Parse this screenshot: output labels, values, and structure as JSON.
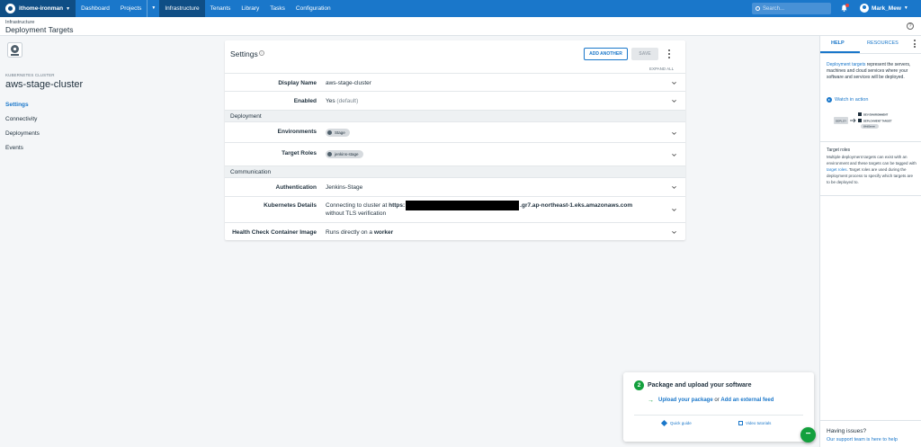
{
  "topbar": {
    "space_name": "ithome-ironman",
    "nav": [
      "Dashboard",
      "Projects",
      "Infrastructure",
      "Tenants",
      "Library",
      "Tasks",
      "Configuration"
    ],
    "active_nav": "Infrastructure",
    "search_placeholder": "Search...",
    "user_name": "Mark_Mew",
    "brand_color": "#1a77ca"
  },
  "subheader": {
    "breadcrumb": "Infrastructure",
    "title": "Deployment Targets"
  },
  "target": {
    "kind": "KUBERNETES CLUSTER",
    "name": "aws-stage-cluster",
    "nav": [
      "Settings",
      "Connectivity",
      "Deployments",
      "Events"
    ],
    "active_nav": "Settings"
  },
  "settings": {
    "title": "Settings",
    "add_another": "ADD ANOTHER",
    "save": "SAVE",
    "expand_all": "EXPAND ALL",
    "rows": {
      "display_name": {
        "label": "Display Name",
        "value": "aws-stage-cluster"
      },
      "enabled": {
        "label": "Enabled",
        "value": "Yes",
        "note": "(default)"
      },
      "environments": {
        "label": "Environments",
        "chip": "Stage"
      },
      "target_roles": {
        "label": "Target Roles",
        "chip": "jenkins-stage"
      },
      "authentication": {
        "label": "Authentication",
        "value": "Jenkins-Stage"
      },
      "kubernetes_details": {
        "label": "Kubernetes Details",
        "prefix": "Connecting to cluster at ",
        "url_start": "https:",
        "url_end": ".gr7.ap-northeast-1.eks.amazonaws.com",
        "line2": "without TLS verification"
      },
      "health_check": {
        "label": "Health Check Container Image",
        "prefix": "Runs directly on a ",
        "bold": "worker"
      }
    },
    "sections": {
      "deployment": "Deployment",
      "communication": "Communication"
    }
  },
  "help": {
    "tab_help": "HELP",
    "tab_resources": "RESOURCES",
    "intro_link": "Deployment targets",
    "intro_text": " represent the servers, machines and cloud services where your software and services will be deployed.",
    "watch": "Watch in action",
    "diagram": {
      "deploy": "DEPLOY",
      "dev_env": "DEV ENVIRONMENT",
      "deploy_target": "DEPLOYMENT TARGET",
      "webserver": "WebServer"
    },
    "roles_title": "Target roles",
    "roles_text_1": "Multiple deployment targets can exist with an environment and these targets can be tagged with ",
    "roles_link": "target roles",
    "roles_text_2": ". Target roles are used during the deployment process to specify which targets are to be deployed to.",
    "issues": "Having issues?",
    "support": "Our support team is here to help"
  },
  "onboarding": {
    "step": "2",
    "title": "Package and upload your software",
    "link1": "Upload your package",
    "or": " or ",
    "link2": "Add an external feed",
    "quick_guide": "Quick guide",
    "video_tutorials": "Video tutorials",
    "accent": "#13a03d"
  }
}
